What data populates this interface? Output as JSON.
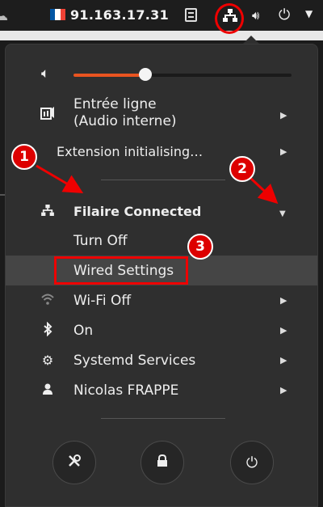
{
  "topbar": {
    "ip": "91.163.17.31",
    "flag_colors": [
      "#0055a4",
      "#ffffff",
      "#ef4135"
    ],
    "icons": [
      "cloud-icon",
      "clipboard-icon",
      "network-icon",
      "volume-icon",
      "power-icon",
      "chevron-down-icon"
    ]
  },
  "menu": {
    "volume_level": 0.33,
    "accent_color": "#e95420",
    "audio_input": {
      "line1": "Entrée ligne",
      "line2": "(Audio interne)"
    },
    "extension": "Extension initialising…",
    "network": {
      "title": "Filaire Connected",
      "turn_off": "Turn Off",
      "settings": "Wired Settings"
    },
    "wifi": "Wi-Fi Off",
    "bluetooth": "On",
    "systemd": "Systemd Services",
    "user": "Nicolas FRAPPE",
    "bottom_buttons": [
      "settings-icon",
      "lock-icon",
      "power-icon"
    ]
  },
  "annotations": {
    "marker_1": "1",
    "marker_2": "2",
    "marker_3": "3",
    "color": "#e00000"
  }
}
